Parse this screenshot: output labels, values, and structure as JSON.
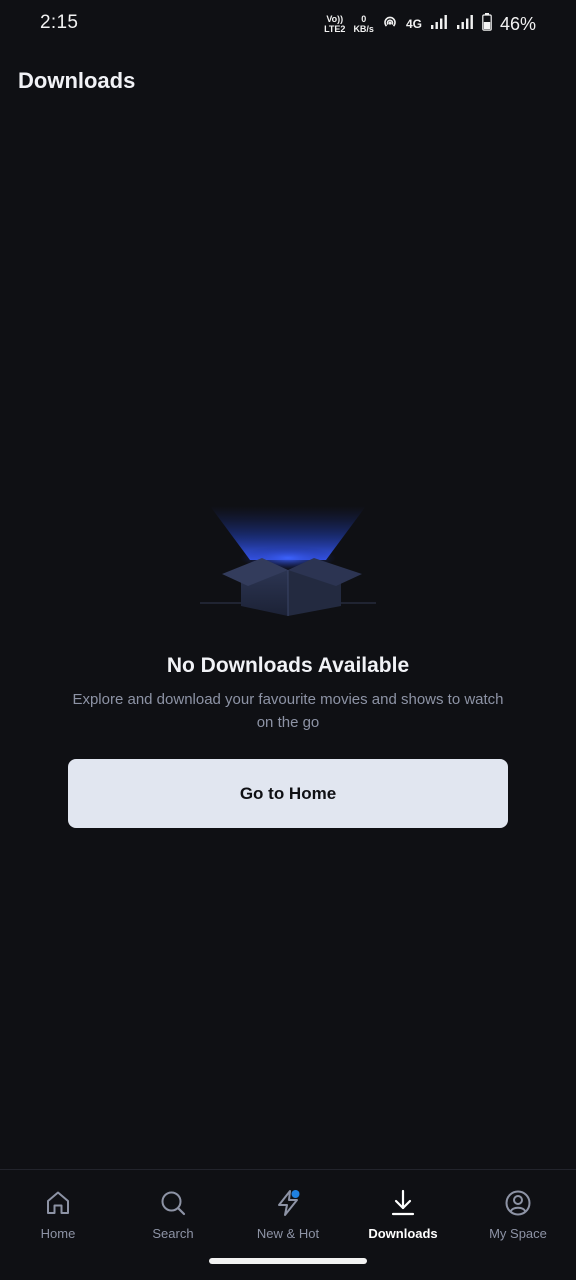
{
  "status_bar": {
    "time": "2:15",
    "volte_line1": "Vo))",
    "volte_line2": "LTE2",
    "speed_value": "0",
    "speed_unit": "KB/s",
    "network_type": "4G",
    "battery_percent": "46%"
  },
  "header": {
    "title": "Downloads"
  },
  "empty_state": {
    "title": "No Downloads Available",
    "description": "Explore and download your favourite movies and shows to watch on the go",
    "button_label": "Go to Home",
    "illustration_icon": "open-box-icon"
  },
  "bottom_nav": {
    "active_tab": "Downloads",
    "items": [
      {
        "label": "Home",
        "icon": "home-icon"
      },
      {
        "label": "Search",
        "icon": "search-icon"
      },
      {
        "label": "New & Hot",
        "icon": "lightning-icon"
      },
      {
        "label": "Downloads",
        "icon": "download-icon"
      },
      {
        "label": "My Space",
        "icon": "profile-icon"
      }
    ]
  },
  "colors": {
    "background": "#0f1014",
    "button_bg": "#e1e6f0",
    "muted_text": "#8d93a5",
    "accent_dot": "#1f80e0"
  }
}
